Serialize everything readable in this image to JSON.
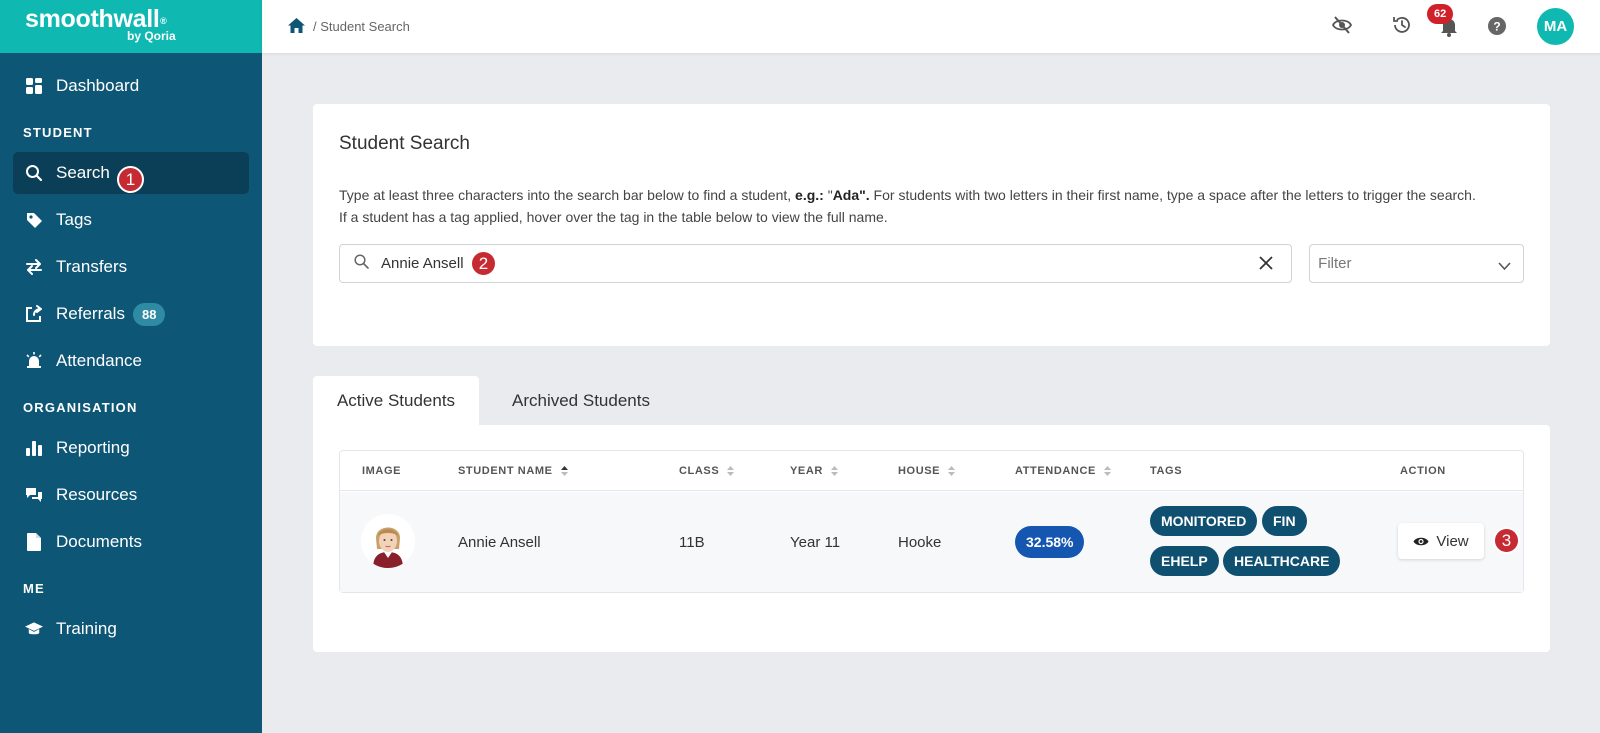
{
  "brand": {
    "name": "smoothwall",
    "mark": "®",
    "sub": "by Qoria"
  },
  "sidebar": {
    "items": [
      {
        "label": "Dashboard"
      }
    ],
    "sections": {
      "student": "STUDENT",
      "organisation": "ORGANISATION",
      "me": "ME"
    },
    "student_items": [
      {
        "label": "Search",
        "active": true
      },
      {
        "label": "Tags"
      },
      {
        "label": "Transfers"
      },
      {
        "label": "Referrals",
        "badge": "88"
      },
      {
        "label": "Attendance"
      }
    ],
    "organisation_items": [
      {
        "label": "Reporting"
      },
      {
        "label": "Resources"
      },
      {
        "label": "Documents"
      }
    ],
    "me_items": [
      {
        "label": "Training"
      }
    ]
  },
  "steps": {
    "one": "1",
    "two": "2",
    "three": "3"
  },
  "topbar": {
    "breadcrumb": "/ Student Search",
    "notifications": "62",
    "avatar": "MA",
    "icons": [
      "eye-off-icon",
      "history-icon",
      "bell-icon",
      "help-icon"
    ]
  },
  "search_card": {
    "title": "Student Search",
    "help_1a": "Type at least three characters into the search bar below to find a student, ",
    "help_1b": "e.g.:",
    "help_1c": " \"",
    "help_1d": "Ada",
    "help_1e": "\".",
    "help_1f": " For students with two letters in their first name, type a space after the letters to trigger the search.",
    "help_2": "If a student has a tag applied, hover over the tag in the table below to view the full name.",
    "search_value": "Annie Ansell",
    "filter_placeholder": "Filter"
  },
  "tabs": {
    "active": "Active Students",
    "archived": "Archived Students"
  },
  "table": {
    "headers": {
      "image": "IMAGE",
      "name": "STUDENT NAME",
      "class": "CLASS",
      "year": "YEAR",
      "house": "HOUSE",
      "attendance": "ATTENDANCE",
      "tags": "TAGS",
      "action": "ACTION"
    },
    "rows": [
      {
        "name": "Annie Ansell",
        "class": "11B",
        "year": "Year 11",
        "house": "Hooke",
        "attendance": "32.58%",
        "tags": [
          "MONITORED",
          "FIN",
          "EHELP",
          "HEALTHCARE"
        ],
        "action": "View"
      }
    ]
  },
  "colors": {
    "sidebar": "#0e5676",
    "brand": "#0fb9b1",
    "accent_red": "#c62a33",
    "attendance": "#1557b0",
    "tag": "#0f5070"
  }
}
